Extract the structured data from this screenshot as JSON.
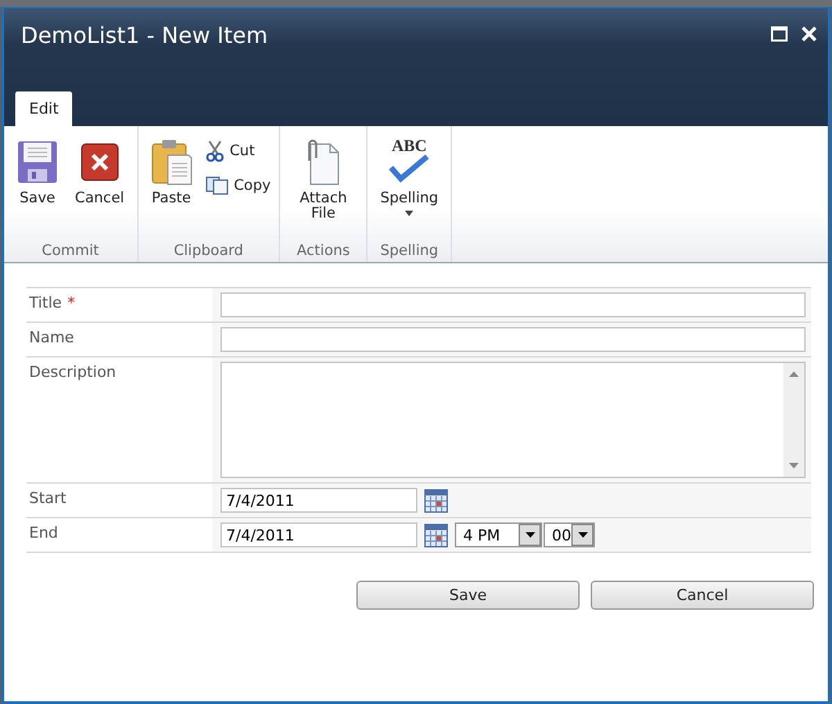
{
  "window": {
    "title": "DemoList1 - New Item"
  },
  "tabs": [
    {
      "label": "Edit",
      "selected": true
    }
  ],
  "ribbon": {
    "groups": [
      {
        "label": "Commit",
        "items": [
          {
            "kind": "large",
            "label": "Save"
          },
          {
            "kind": "large",
            "label": "Cancel"
          }
        ]
      },
      {
        "label": "Clipboard",
        "items": [
          {
            "kind": "large",
            "label": "Paste"
          },
          {
            "kind": "small",
            "label": "Cut"
          },
          {
            "kind": "small",
            "label": "Copy"
          }
        ]
      },
      {
        "label": "Actions",
        "items": [
          {
            "kind": "large",
            "label": "Attach File"
          }
        ]
      },
      {
        "label": "Spelling",
        "items": [
          {
            "kind": "dropdown",
            "label": "Spelling",
            "icon_text": "ABC"
          }
        ]
      }
    ]
  },
  "fields": [
    {
      "kind": "text",
      "label": "Title",
      "required_mark": "*"
    },
    {
      "kind": "text",
      "label": "Name"
    },
    {
      "kind": "textarea",
      "label": "Description"
    },
    {
      "kind": "date",
      "label": "Start",
      "date": "7/4/2011"
    },
    {
      "kind": "datetime",
      "label": "End",
      "date": "7/4/2011",
      "hour": "4 PM",
      "minute": "00"
    }
  ],
  "buttons": [
    "Save",
    "Cancel"
  ]
}
